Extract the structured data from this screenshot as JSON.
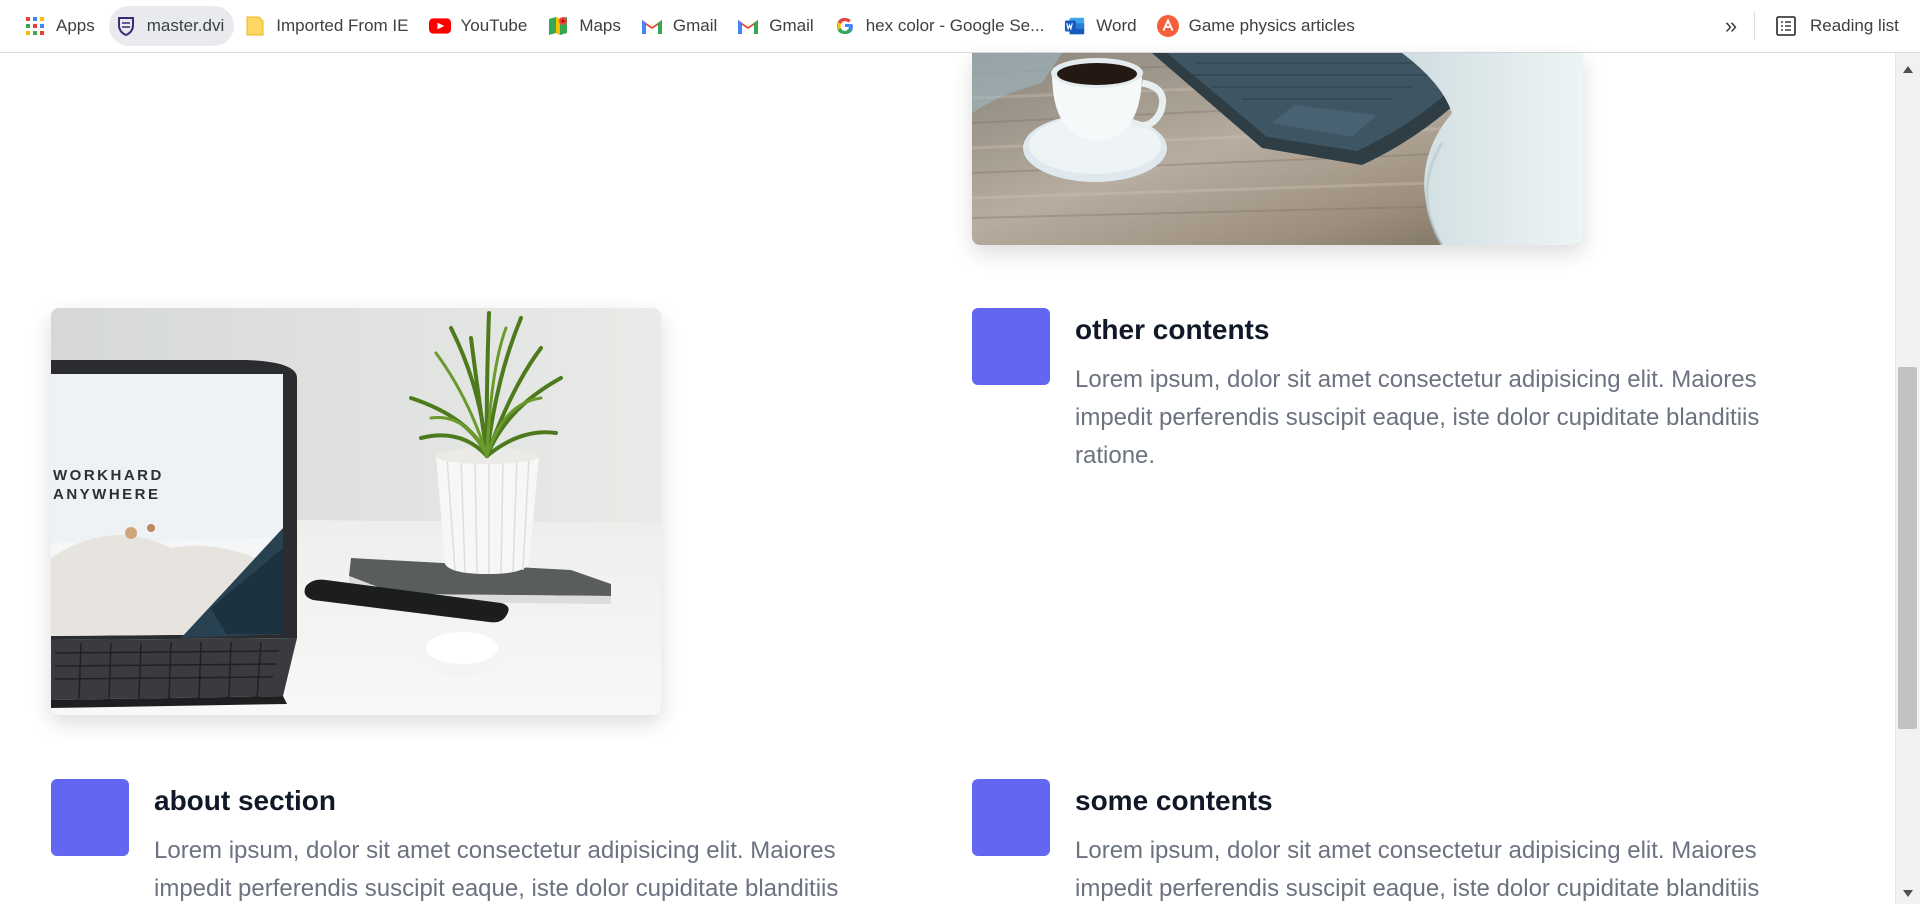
{
  "bookmarks": [
    {
      "label": "Apps",
      "icon": "apps-grid-icon"
    },
    {
      "label": "master.dvi",
      "icon": "master-dvi-icon"
    },
    {
      "label": "Imported From IE",
      "icon": "folder-icon"
    },
    {
      "label": "YouTube",
      "icon": "youtube-icon"
    },
    {
      "label": "Maps",
      "icon": "maps-icon"
    },
    {
      "label": "Gmail",
      "icon": "gmail-icon"
    },
    {
      "label": "Gmail",
      "icon": "gmail-icon"
    },
    {
      "label": "hex color - Google Se...",
      "icon": "google-icon"
    },
    {
      "label": "Word",
      "icon": "word-icon"
    },
    {
      "label": "Game physics articles",
      "icon": "game-physics-icon"
    }
  ],
  "bookmarks_more": "»",
  "reading_list": {
    "label": "Reading list",
    "icon": "reading-list-icon"
  },
  "images": {
    "top_right": {
      "subject": "coffee cup beside laptop on wooden desk"
    },
    "middle_left": {
      "subject": "laptop with plant and phone on desk",
      "screen_text": [
        "WORKHARD",
        "ANYWHERE"
      ]
    }
  },
  "features": [
    {
      "title": "other contents",
      "text": "Lorem ipsum, dolor sit amet consectetur adipisicing elit. Maiores impedit perferendis suscipit eaque, iste dolor cupiditate blanditiis ratione."
    },
    {
      "title": "about section",
      "text": "Lorem ipsum, dolor sit amet consectetur adipisicing elit. Maiores impedit perferendis suscipit eaque, iste dolor cupiditate blanditiis"
    },
    {
      "title": "some contents",
      "text": "Lorem ipsum, dolor sit amet consectetur adipisicing elit. Maiores impedit perferendis suscipit eaque, iste dolor cupiditate blanditiis"
    }
  ],
  "colors": {
    "accent": "#6366f1",
    "heading": "#111827",
    "body_text": "#6b7280"
  }
}
